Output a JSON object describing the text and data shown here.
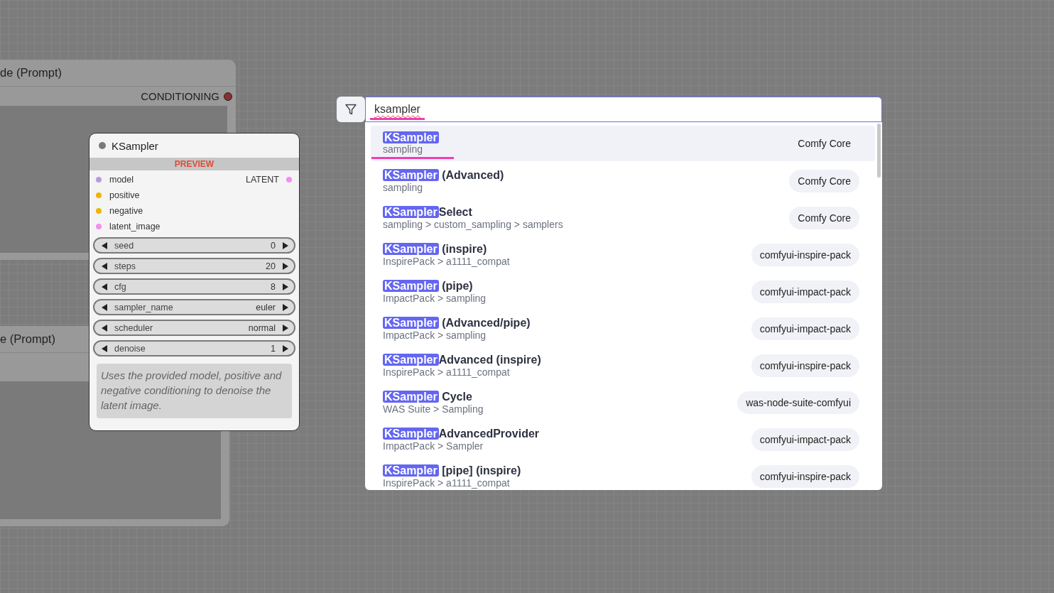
{
  "background_nodes": [
    {
      "title": "de (Prompt)",
      "output": {
        "label": "CONDITIONING",
        "color": "#8c2f2f"
      }
    },
    {
      "title": "e (Prompt)"
    }
  ],
  "node": {
    "title": "KSampler",
    "banner": "PREVIEW",
    "inputs": [
      {
        "label": "model",
        "color": "#b39ddb"
      },
      {
        "label": "positive",
        "color": "#f0b400"
      },
      {
        "label": "negative",
        "color": "#f0b400"
      },
      {
        "label": "latent_image",
        "color": "#f48cf4"
      }
    ],
    "outputs": [
      {
        "label": "LATENT",
        "color": "#f48cf4"
      }
    ],
    "widgets": [
      {
        "name": "seed",
        "value": "0"
      },
      {
        "name": "steps",
        "value": "20"
      },
      {
        "name": "cfg",
        "value": "8"
      },
      {
        "name": "sampler_name",
        "value": "euler"
      },
      {
        "name": "scheduler",
        "value": "normal"
      },
      {
        "name": "denoise",
        "value": "1"
      }
    ],
    "description": "Uses the provided model, positive and negative conditioning to denoise the latent image."
  },
  "search": {
    "value": "ksampler",
    "results": [
      {
        "match": "KSampler",
        "category": "sampling",
        "source": "Comfy Core",
        "selected": true
      },
      {
        "match": "KSampler",
        "rest": " (Advanced)",
        "category": "sampling",
        "source": "Comfy Core",
        "selected": false
      },
      {
        "match": "KSampler",
        "rest": "Select",
        "category": "sampling > custom_sampling > samplers",
        "source": "Comfy Core",
        "selected": false
      },
      {
        "match": "KSampler",
        "rest": " (inspire)",
        "category": "InspirePack > a1111_compat",
        "source": "comfyui-inspire-pack",
        "selected": false
      },
      {
        "match": "KSampler",
        "rest": " (pipe)",
        "category": "ImpactPack > sampling",
        "source": "comfyui-impact-pack",
        "selected": false
      },
      {
        "match": "KSampler",
        "rest": " (Advanced/pipe)",
        "category": "ImpactPack > sampling",
        "source": "comfyui-impact-pack",
        "selected": false
      },
      {
        "match": "KSampler",
        "rest": "Advanced (inspire)",
        "category": "InspirePack > a1111_compat",
        "source": "comfyui-inspire-pack",
        "selected": false
      },
      {
        "match": "KSampler",
        "rest": " Cycle",
        "category": "WAS Suite > Sampling",
        "source": "was-node-suite-comfyui",
        "selected": false
      },
      {
        "match": "KSampler",
        "rest": "AdvancedProvider",
        "category": "ImpactPack > Sampler",
        "source": "comfyui-impact-pack",
        "selected": false
      },
      {
        "match": "KSampler",
        "rest": " [pipe] (inspire)",
        "category": "InspirePack > a1111_compat",
        "source": "comfyui-inspire-pack",
        "selected": false
      }
    ]
  }
}
